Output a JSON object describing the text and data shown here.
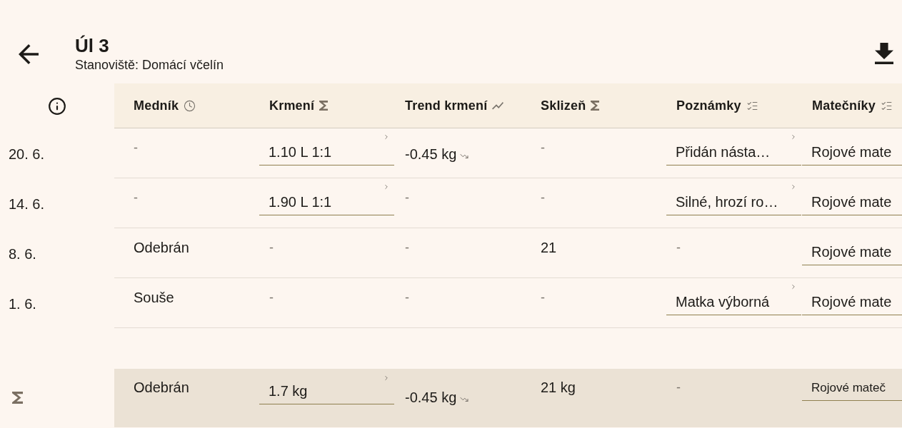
{
  "header": {
    "title": "Úl 3",
    "subtitle": "Stanoviště: Domácí včelín"
  },
  "table": {
    "columns": [
      {
        "label": "Medník",
        "kind": "history"
      },
      {
        "label": "Krmení",
        "kind": "sum"
      },
      {
        "label": "Trend krmení",
        "kind": "trend"
      },
      {
        "label": "Sklizeň",
        "kind": "sum"
      },
      {
        "label": "Poznámky",
        "kind": "checklist"
      },
      {
        "label": "Matečníky",
        "kind": "checklist"
      }
    ],
    "rows": [
      {
        "date": "20. 6.",
        "cells": [
          {
            "kind": "empty",
            "text": "-"
          },
          {
            "kind": "field",
            "text": "1.10 L 1:1",
            "chevron": true
          },
          {
            "kind": "trend",
            "text": "-0.45 kg"
          },
          {
            "kind": "empty",
            "text": "-"
          },
          {
            "kind": "field",
            "text": "Přidán násta…",
            "chevron": true
          },
          {
            "kind": "field",
            "text": "Rojové mate",
            "chevron": false
          }
        ]
      },
      {
        "date": "14. 6.",
        "cells": [
          {
            "kind": "empty",
            "text": "-"
          },
          {
            "kind": "field",
            "text": "1.90 L 1:1",
            "chevron": true
          },
          {
            "kind": "empty",
            "text": "-"
          },
          {
            "kind": "empty",
            "text": "-"
          },
          {
            "kind": "field",
            "text": "Silné, hrozí ro…",
            "chevron": true
          },
          {
            "kind": "field",
            "text": "Rojové mate",
            "chevron": false
          }
        ]
      },
      {
        "date": "8. 6.",
        "cells": [
          {
            "kind": "text",
            "text": "Odebrán"
          },
          {
            "kind": "empty",
            "text": "-"
          },
          {
            "kind": "empty",
            "text": "-"
          },
          {
            "kind": "text",
            "text": "21"
          },
          {
            "kind": "empty",
            "text": "-"
          },
          {
            "kind": "field",
            "text": "Rojové mate",
            "chevron": false
          }
        ]
      },
      {
        "date": "1. 6.",
        "cells": [
          {
            "kind": "text",
            "text": "Souše"
          },
          {
            "kind": "empty",
            "text": "-"
          },
          {
            "kind": "empty",
            "text": "-"
          },
          {
            "kind": "empty",
            "text": "-"
          },
          {
            "kind": "field",
            "text": "Matka výborná",
            "chevron": true
          },
          {
            "kind": "field",
            "text": "Rojové mate",
            "chevron": false
          }
        ]
      }
    ],
    "summary": {
      "cells": [
        {
          "kind": "text",
          "text": "Odebrán"
        },
        {
          "kind": "field",
          "text": "1.7 kg",
          "chevron": true
        },
        {
          "kind": "trend",
          "text": "-0.45 kg"
        },
        {
          "kind": "text",
          "text": "21 kg"
        },
        {
          "kind": "empty",
          "text": "-"
        },
        {
          "kind": "field",
          "text": "Rojové mateč",
          "chevron": false
        }
      ]
    }
  }
}
